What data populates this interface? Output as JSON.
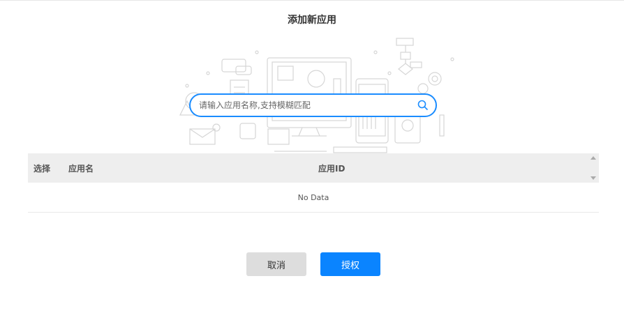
{
  "dialog": {
    "title": "添加新应用"
  },
  "search": {
    "placeholder": "请输入应用名称,支持模糊匹配",
    "value": "",
    "icon": "search-icon"
  },
  "table": {
    "columns": [
      "选择",
      "应用名",
      "应用ID"
    ],
    "empty_text": "No Data"
  },
  "actions": {
    "cancel_label": "取消",
    "authorize_label": "授权"
  },
  "colors": {
    "primary": "#0a84ff",
    "cancel_bg": "#dddddd",
    "header_bg": "#eeeeee"
  }
}
